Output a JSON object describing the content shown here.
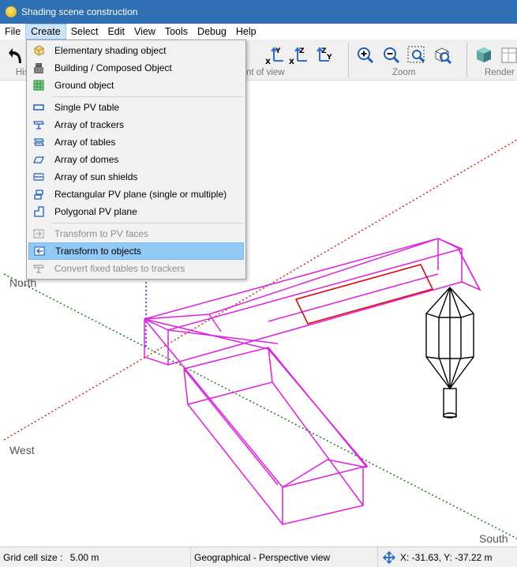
{
  "window": {
    "title": "Shading scene construction"
  },
  "menubar": {
    "items": [
      {
        "label": "File"
      },
      {
        "label": "Create"
      },
      {
        "label": "Select"
      },
      {
        "label": "Edit"
      },
      {
        "label": "View"
      },
      {
        "label": "Tools"
      },
      {
        "label": "Debug"
      },
      {
        "label": "Help"
      }
    ]
  },
  "toolbar": {
    "history_label_partial": "His",
    "point_of_view_label_partial": "nt of view",
    "zoom_label": "Zoom",
    "render_label": "Render",
    "axis_buttons": [
      {
        "top": "Y",
        "bottom": "X"
      },
      {
        "top": "Z",
        "bottom": "X"
      },
      {
        "top": "Z",
        "bottom": "Y"
      }
    ]
  },
  "create_menu": {
    "items": [
      {
        "label": "Elementary shading object",
        "icon": "elementary-shading-icon",
        "enabled": true
      },
      {
        "label": "Building / Composed Object",
        "icon": "building-icon",
        "enabled": true
      },
      {
        "label": "Ground object",
        "icon": "ground-grid-icon",
        "enabled": true
      },
      {
        "label": "Single PV table",
        "icon": "pv-table-icon",
        "enabled": true
      },
      {
        "label": "Array of trackers",
        "icon": "trackers-icon",
        "enabled": true
      },
      {
        "label": "Array of tables",
        "icon": "tables-icon",
        "enabled": true
      },
      {
        "label": "Array of domes",
        "icon": "domes-icon",
        "enabled": true
      },
      {
        "label": "Array of sun shields",
        "icon": "sun-shields-icon",
        "enabled": true
      },
      {
        "label": "Rectangular PV plane (single or multiple)",
        "icon": "rect-pv-plane-icon",
        "enabled": true
      },
      {
        "label": "Polygonal PV plane",
        "icon": "poly-pv-plane-icon",
        "enabled": true
      },
      {
        "label": "Transform to PV faces",
        "icon": "transform-pv-faces-icon",
        "enabled": false
      },
      {
        "label": "Transform to objects",
        "icon": "transform-objects-icon",
        "enabled": true,
        "highlighted": true
      },
      {
        "label": "Convert fixed tables to trackers",
        "icon": "convert-trackers-icon",
        "enabled": false
      }
    ]
  },
  "viewport": {
    "compass": {
      "north": "North",
      "west": "West",
      "south": "South"
    },
    "colors": {
      "buildings": "#e020e0",
      "pv_field": "#dd0000",
      "tree": "#000000",
      "axis_x": "#dd0000",
      "axis_y": "#006600",
      "axis_z": "#0000cc"
    }
  },
  "statusbar": {
    "grid_label": "Grid cell size :",
    "grid_value": "5.00 m",
    "view_mode": "Geographical - Perspective view",
    "coordinates": "X: -31.63, Y: -37.22 m"
  }
}
